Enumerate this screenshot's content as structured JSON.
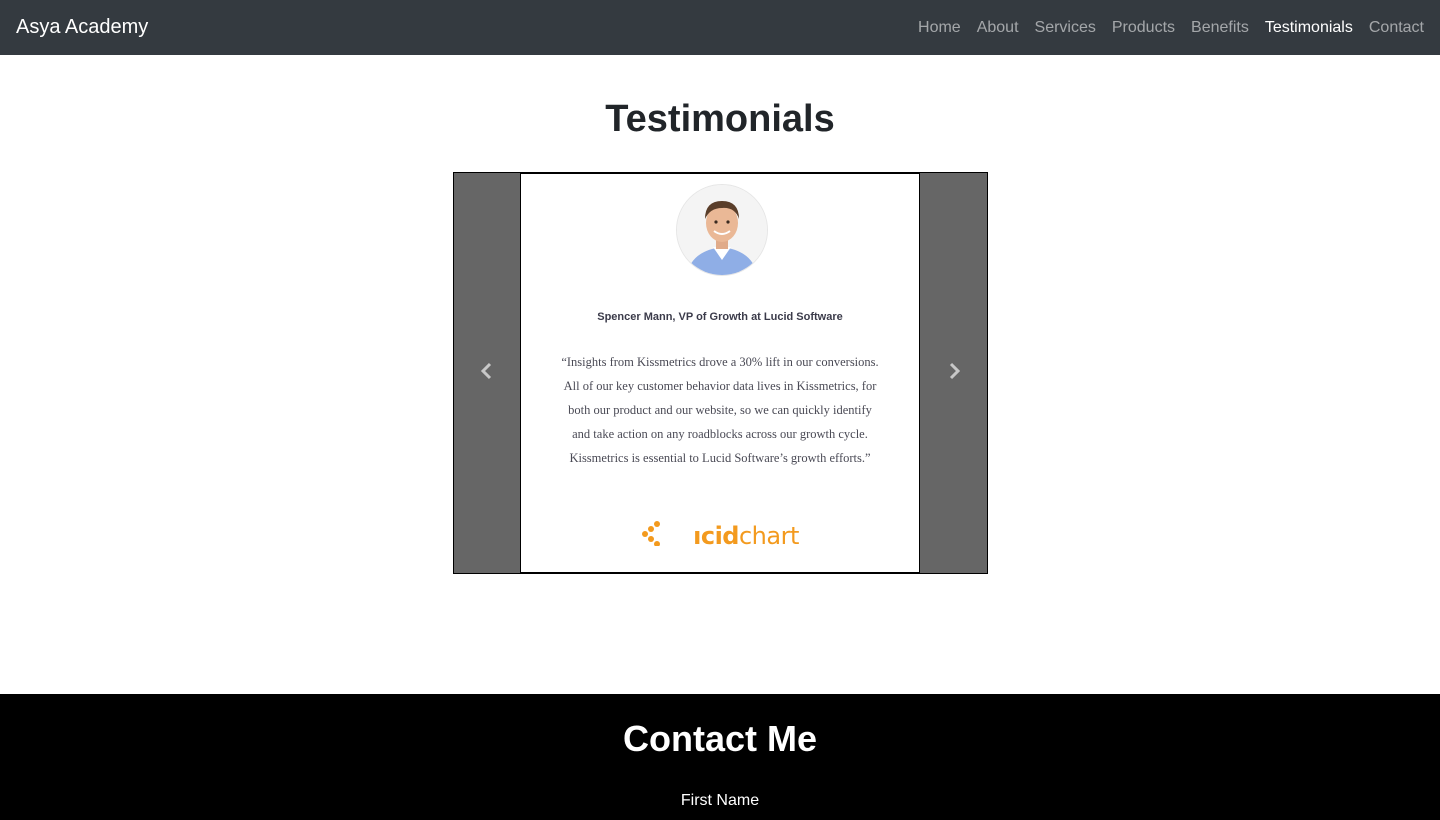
{
  "navbar": {
    "brand": "Asya Academy",
    "links": [
      {
        "label": "Home"
      },
      {
        "label": "About"
      },
      {
        "label": "Services"
      },
      {
        "label": "Products"
      },
      {
        "label": "Benefits"
      },
      {
        "label": "Testimonials",
        "active": true
      },
      {
        "label": "Contact"
      }
    ]
  },
  "testimonials": {
    "title": "Testimonials",
    "slide": {
      "person": "Spencer Mann, VP of Growth at Lucid Software",
      "quote": "“Insights from Kissmetrics drove a 30% lift in our conversions. All of our key customer behavior data lives in Kissmetrics, for both our product and our website, so we can quickly identify and take action on any roadblocks across our growth cycle. Kissmetrics is essential to Lucid Software’s growth efforts.”",
      "logo_text_bold": "ıcid",
      "logo_text_rest": "chart"
    },
    "prev_icon": "chevron-left-icon",
    "next_icon": "chevron-right-icon"
  },
  "contact": {
    "title": "Contact Me",
    "first_name_label": "First Name"
  },
  "colors": {
    "navbar_bg": "#343a40",
    "carousel_bg": "#666666",
    "logo_orange": "#f39a1e",
    "contact_bg": "#000000"
  }
}
